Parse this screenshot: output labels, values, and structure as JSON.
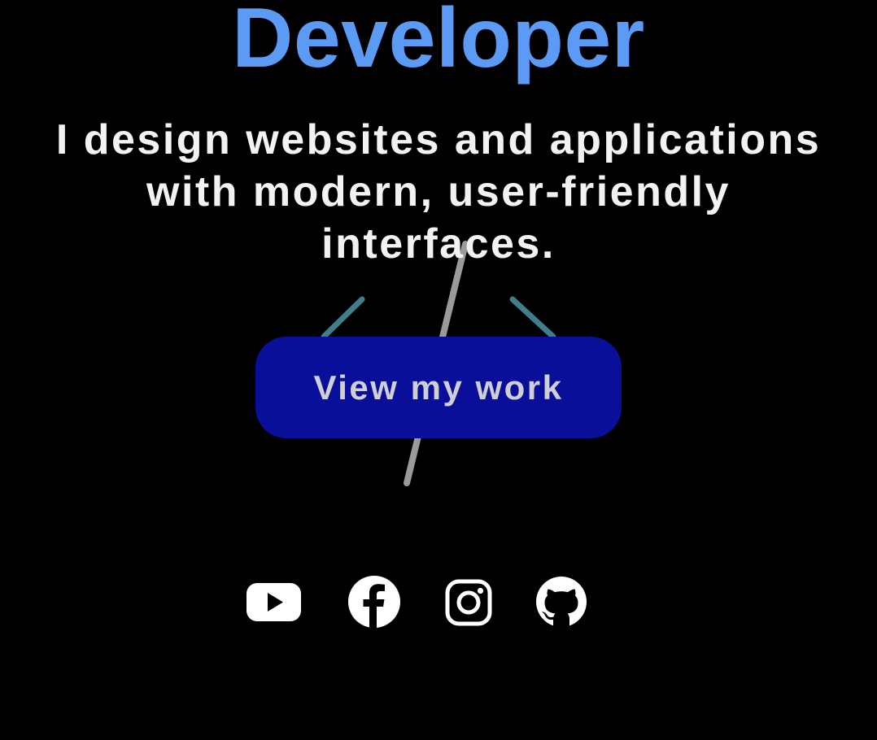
{
  "hero": {
    "title": "Developer",
    "subtitle": "I design websites and applications with modern, user-friendly interfaces.",
    "cta_label": "View my work"
  },
  "social": [
    {
      "icon": "youtube-icon",
      "label": "YouTube"
    },
    {
      "icon": "facebook-icon",
      "label": "Facebook"
    },
    {
      "icon": "instagram-icon",
      "label": "Instagram"
    },
    {
      "icon": "github-icon",
      "label": "GitHub"
    }
  ],
  "colors": {
    "background": "#000000",
    "title": "#5b9bf5",
    "subtitle": "#f2f2f2",
    "button_bg": "#0a0f99",
    "button_text": "#cfcfd8",
    "icon": "#ffffff",
    "bracket_accent": "#3f7f8c",
    "slash": "#9a9a9a"
  }
}
